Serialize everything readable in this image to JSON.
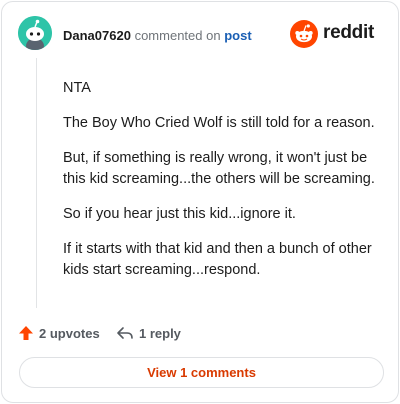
{
  "comment": {
    "author": "Dana07620",
    "commented_on": "commented on",
    "post_link": "post",
    "paragraphs": [
      "NTA",
      "The Boy Who Cried Wolf is still told for a reason.",
      "But, if something is really wrong, it won't just be this kid screaming...the others will be screaming.",
      "So if you hear just this kid...ignore it.",
      "If it starts with that kid and then a bunch of other kids start screaming...respond."
    ]
  },
  "brand": {
    "logo_text": "reddit",
    "color": "#ff4500"
  },
  "actions": {
    "upvotes_label": "2 upvotes",
    "reply_label": "1 reply",
    "view_comments_label": "View 1 comments"
  },
  "colors": {
    "avatar": "#2ec4a8",
    "link": "#1a5fb4",
    "accent": "#d93a00"
  },
  "icons": {
    "avatar": "snoo-avatar-icon",
    "upvote": "upvote-arrow-icon",
    "reply": "reply-arrow-icon",
    "logo": "reddit-logo-icon"
  }
}
